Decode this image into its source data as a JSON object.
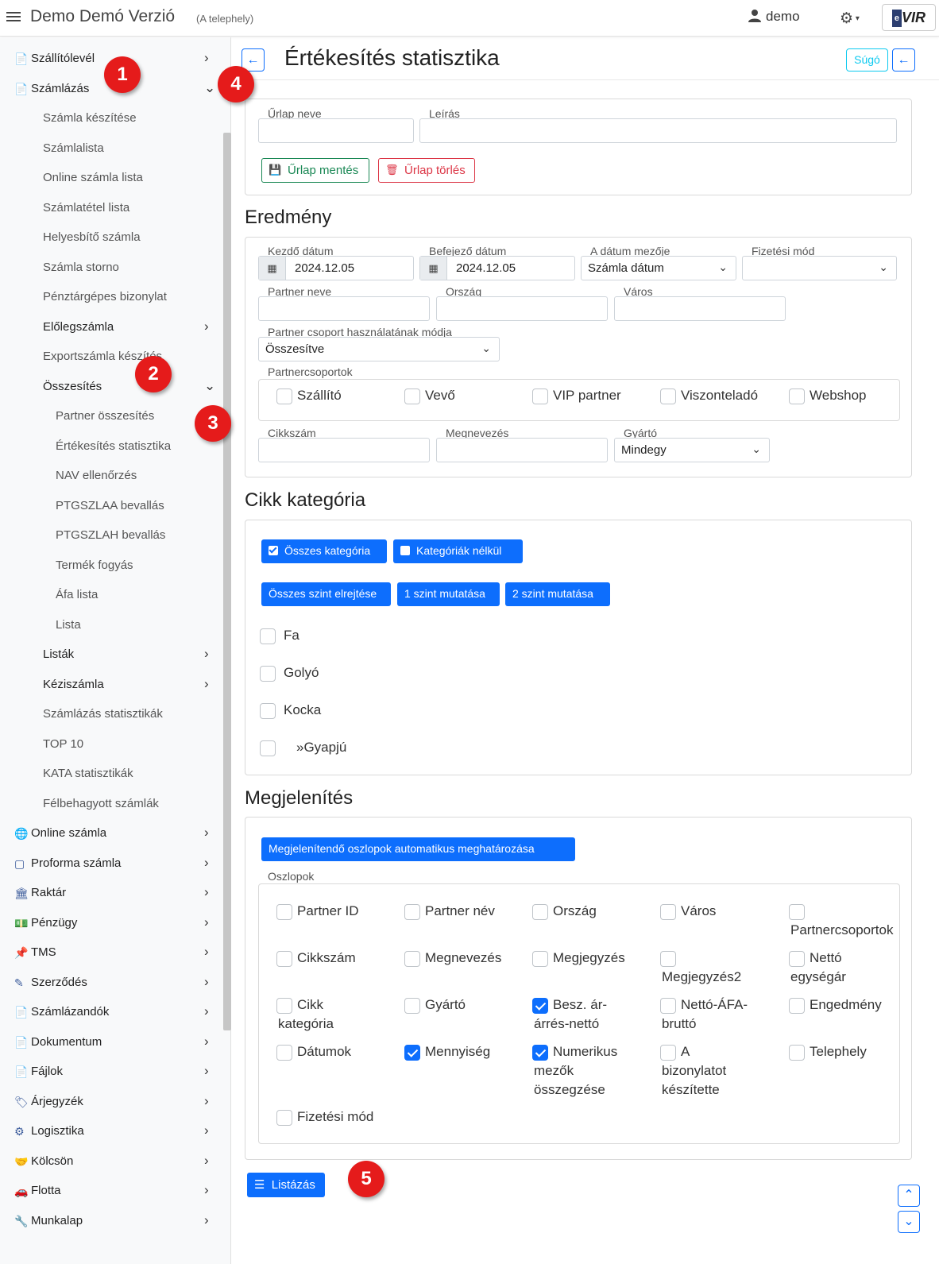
{
  "topbar": {
    "title": "Demo Demó Verzió",
    "subtitle": "(A telephely)",
    "user": "demo",
    "logo_text": "VIR",
    "logo_prefix": "e"
  },
  "sidebar": {
    "items": [
      {
        "label": "Szállítólevél",
        "level": 1
      },
      {
        "label": "Számlázás",
        "level": 1
      },
      {
        "label": "Számla készítése",
        "level": 2
      },
      {
        "label": "Számlalista",
        "level": 2
      },
      {
        "label": "Online számla lista",
        "level": 2
      },
      {
        "label": "Számlatétel lista",
        "level": 2
      },
      {
        "label": "Helyesbítő számla",
        "level": 2
      },
      {
        "label": "Számla storno",
        "level": 2
      },
      {
        "label": "Pénztárgépes bizonylat",
        "level": 2
      },
      {
        "label": "Előlegszámla",
        "level": 2
      },
      {
        "label": "Exportszámla készítés",
        "level": 2
      },
      {
        "label": "Összesítés",
        "level": 2
      },
      {
        "label": "Partner összesítés",
        "level": 3
      },
      {
        "label": "Értékesítés statisztika",
        "level": 3
      },
      {
        "label": "NAV ellenőrzés",
        "level": 3
      },
      {
        "label": "PTGSZLAA bevallás",
        "level": 3
      },
      {
        "label": "PTGSZLAH bevallás",
        "level": 3
      },
      {
        "label": "Termék fogyás",
        "level": 3
      },
      {
        "label": "Áfa lista",
        "level": 3
      },
      {
        "label": "Lista",
        "level": 3
      },
      {
        "label": "Listák",
        "level": 2
      },
      {
        "label": "Kéziszámla",
        "level": 2
      },
      {
        "label": "Számlázás statisztikák",
        "level": 2
      },
      {
        "label": "TOP 10",
        "level": 2
      },
      {
        "label": "KATA statisztikák",
        "level": 2
      },
      {
        "label": "Félbehagyott számlák",
        "level": 2
      },
      {
        "label": "Online számla",
        "level": 1
      },
      {
        "label": "Proforma számla",
        "level": 1
      },
      {
        "label": "Raktár",
        "level": 1
      },
      {
        "label": "Pénzügy",
        "level": 1
      },
      {
        "label": "TMS",
        "level": 1
      },
      {
        "label": "Szerződés",
        "level": 1
      },
      {
        "label": "Számlázandók",
        "level": 1
      },
      {
        "label": "Dokumentum",
        "level": 1
      },
      {
        "label": "Fájlok",
        "level": 1
      },
      {
        "label": "Árjegyzék",
        "level": 1
      },
      {
        "label": "Logisztika",
        "level": 1
      },
      {
        "label": "Kölcsön",
        "level": 1
      },
      {
        "label": "Flotta",
        "level": 1
      },
      {
        "label": "Munkalap",
        "level": 1
      }
    ]
  },
  "page": {
    "title": "Értékesítés statisztika",
    "help_label": "Súgó"
  },
  "form_card": {
    "name_label": "Űrlap neve",
    "desc_label": "Leírás",
    "save_label": "Űrlap mentés",
    "delete_label": "Űrlap törlés"
  },
  "result": {
    "title": "Eredmény",
    "start_date_label": "Kezdő dátum",
    "start_date": "2024.12.05",
    "end_date_label": "Befejező dátum",
    "end_date": "2024.12.05",
    "date_field_label": "A dátum mezője",
    "date_field_value": "Számla dátum",
    "payment_label": "Fizetési mód",
    "payment_value": "",
    "partner_name_label": "Partner neve",
    "country_label": "Ország",
    "city_label": "Város",
    "group_mode_label": "Partner csoport használatának módja",
    "group_mode_value": "Összesítve",
    "groups_label": "Partnercsoportok",
    "groups": [
      "Szállító",
      "Vevő",
      "VIP partner",
      "Viszonteladó",
      "Webshop"
    ],
    "sku_label": "Cikkszám",
    "item_name_label": "Megnevezés",
    "maker_label": "Gyártó",
    "maker_value": "Mindegy"
  },
  "category": {
    "title": "Cikk kategória",
    "all_label": "Összes kategória",
    "none_label": "Kategóriák nélkül",
    "hide_all_label": "Összes szint elrejtése",
    "show1_label": "1 szint mutatása",
    "show2_label": "2 szint mutatása",
    "items": [
      "Fa",
      "Golyó",
      "Kocka",
      "»Gyapjú"
    ]
  },
  "display": {
    "title": "Megjelenítés",
    "auto_label": "Megjelenítendő oszlopok automatikus meghatározása",
    "columns_label": "Oszlopok",
    "columns": [
      {
        "l1": "Partner ID",
        "l2": "",
        "l3": "",
        "checked": false
      },
      {
        "l1": "Partner név",
        "l2": "",
        "l3": "",
        "checked": false
      },
      {
        "l1": "Ország",
        "l2": "",
        "l3": "",
        "checked": false
      },
      {
        "l1": "Város",
        "l2": "",
        "l3": "",
        "checked": false
      },
      {
        "l1": "",
        "l2": "Partnercsoportok",
        "l3": "",
        "checked": false
      },
      {
        "l1": "Cikkszám",
        "l2": "",
        "l3": "",
        "checked": false
      },
      {
        "l1": "Megnevezés",
        "l2": "",
        "l3": "",
        "checked": false
      },
      {
        "l1": "Megjegyzés",
        "l2": "",
        "l3": "",
        "checked": false
      },
      {
        "l1": "",
        "l2": "Megjegyzés2",
        "l3": "",
        "checked": false
      },
      {
        "l1": "Nettó",
        "l2": "egységár",
        "l3": "",
        "checked": false
      },
      {
        "l1": "Cikk",
        "l2": "kategória",
        "l3": "",
        "checked": false
      },
      {
        "l1": "Gyártó",
        "l2": "",
        "l3": "",
        "checked": false
      },
      {
        "l1": "Besz. ár-",
        "l2": "árrés-nettó",
        "l3": "",
        "checked": true
      },
      {
        "l1": "Nettó-ÁFA-",
        "l2": "bruttó",
        "l3": "",
        "checked": false
      },
      {
        "l1": "Engedmény",
        "l2": "",
        "l3": "",
        "checked": false
      },
      {
        "l1": "Dátumok",
        "l2": "",
        "l3": "",
        "checked": false
      },
      {
        "l1": "Mennyiség",
        "l2": "",
        "l3": "",
        "checked": true
      },
      {
        "l1": "Numerikus",
        "l2": "mezők",
        "l3": "összegzése",
        "checked": true
      },
      {
        "l1": "A",
        "l2": "bizonylatot",
        "l3": "készítette",
        "checked": false
      },
      {
        "l1": "Telephely",
        "l2": "",
        "l3": "",
        "checked": false
      },
      {
        "l1": "Fizetési mód",
        "l2": "",
        "l3": "",
        "checked": false
      }
    ],
    "list_label": "Listázás"
  },
  "badges": [
    "1",
    "2",
    "3",
    "4",
    "5"
  ],
  "colors": {
    "primary": "#0d6efd",
    "success": "#198754",
    "danger": "#dc3545",
    "badge": "#e51b1b",
    "info": "#0dcaf0"
  }
}
